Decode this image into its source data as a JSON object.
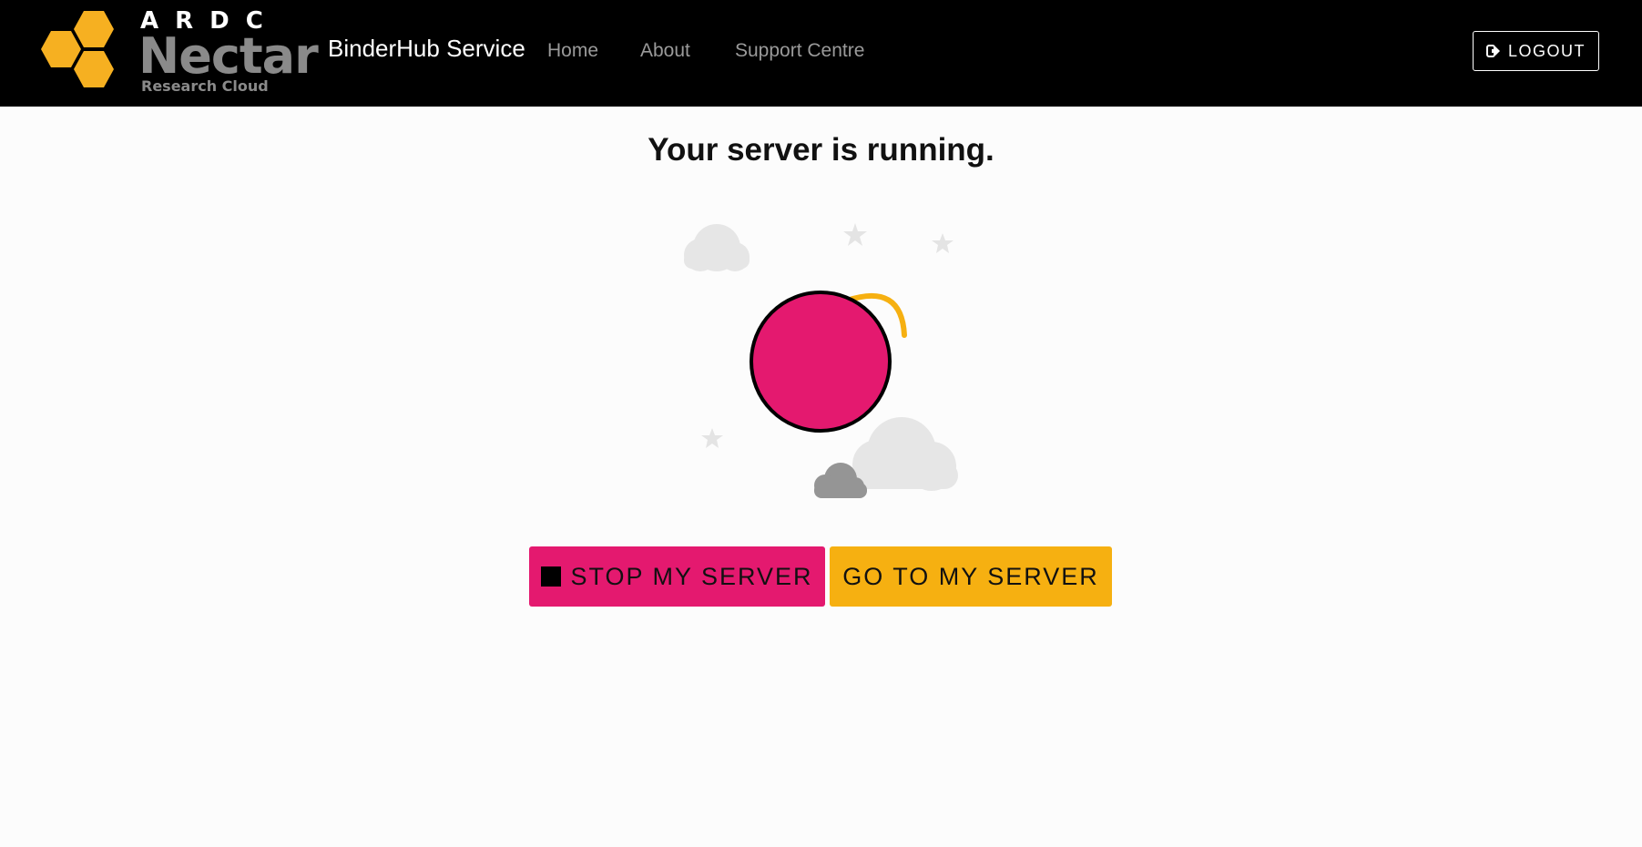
{
  "navbar": {
    "logo": {
      "top_text": "ARDC",
      "main_text": "Nectar",
      "sub_text": "Research Cloud"
    },
    "brand": "BinderHub Service",
    "links": [
      "Home",
      "About",
      "Support Centre"
    ],
    "logout_label": "LOGOUT"
  },
  "main": {
    "heading": "Your server is running.",
    "stop_button_label": "STOP MY SERVER",
    "go_button_label": "GO TO MY SERVER"
  },
  "colors": {
    "navbar_bg": "#000000",
    "accent_pink": "#e4196f",
    "accent_yellow": "#f6b011",
    "hexagon_gold": "#f6b021"
  },
  "icons": {
    "logout": "sign-out-icon",
    "stop": "stop-square-icon"
  }
}
